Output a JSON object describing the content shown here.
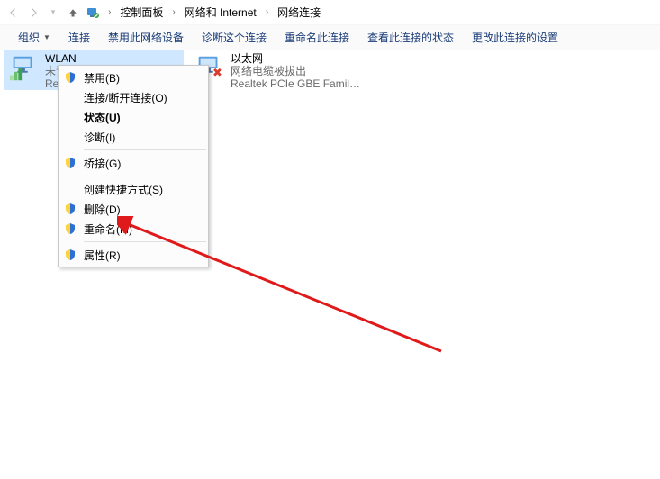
{
  "breadcrumb": {
    "item0": "控制面板",
    "item1": "网络和 Internet",
    "item2": "网络连接"
  },
  "toolbar": {
    "organize": "组织",
    "connect": "连接",
    "disable": "禁用此网络设备",
    "diagnose": "诊断这个连接",
    "rename": "重命名此连接",
    "viewStatus": "查看此连接的状态",
    "changeSettings": "更改此连接的设置"
  },
  "connections": {
    "wlan": {
      "name": "WLAN",
      "status": "未识别的网络",
      "adapter": "Rea..."
    },
    "ethernet": {
      "name": "以太网",
      "status": "网络电缆被拔出",
      "adapter": "Realtek PCIe GBE Family Contr..."
    }
  },
  "menu": {
    "disable": "禁用(B)",
    "connect": "连接/断开连接(O)",
    "status": "状态(U)",
    "diagnose": "诊断(I)",
    "bridge": "桥接(G)",
    "shortcut": "创建快捷方式(S)",
    "delete": "删除(D)",
    "rename": "重命名(M)",
    "properties": "属性(R)"
  }
}
